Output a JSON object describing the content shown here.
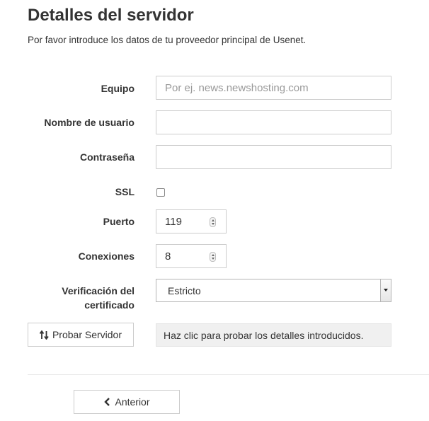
{
  "header": {
    "title": "Detalles del servidor",
    "subtitle": "Por favor introduce los datos de tu proveedor principal de Usenet."
  },
  "form": {
    "host": {
      "label": "Equipo",
      "value": "",
      "placeholder": "Por ej. news.newshosting.com"
    },
    "username": {
      "label": "Nombre de usuario",
      "value": ""
    },
    "password": {
      "label": "Contraseña",
      "value": ""
    },
    "ssl": {
      "label": "SSL",
      "checked": false
    },
    "port": {
      "label": "Puerto",
      "value": "119"
    },
    "connections": {
      "label": "Conexiones",
      "value": "8"
    },
    "cert": {
      "label_line1": "Verificación del",
      "label_line2": "certificado",
      "selected": "Estricto"
    }
  },
  "test": {
    "button_label": "Probar Servidor",
    "message": "Haz clic para probar los detalles introducidos."
  },
  "nav": {
    "back_label": "Anterior"
  },
  "icons": {
    "test": "sort-arrows-icon",
    "back": "chevron-left-icon"
  }
}
